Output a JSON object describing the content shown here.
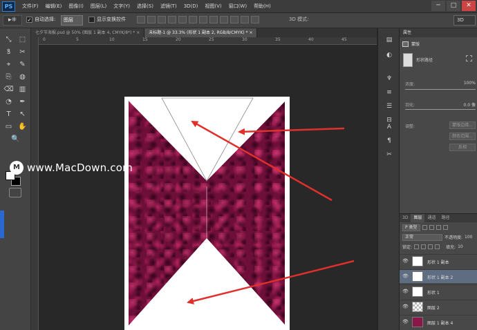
{
  "app": {
    "logo": "PS"
  },
  "menu": [
    "文件(F)",
    "编辑(E)",
    "图像(I)",
    "图层(L)",
    "文字(Y)",
    "选择(S)",
    "滤镜(T)",
    "3D(D)",
    "视图(V)",
    "窗口(W)",
    "帮助(H)"
  ],
  "window_controls": {
    "minimize": "─",
    "maximize": "□",
    "close": "✕"
  },
  "options": {
    "move_tool": "▸⁜",
    "auto_select_label": "自动选择:",
    "auto_select_value": "图层",
    "show_transform_label": "显示变换控件",
    "mode_3d_label": "3D 模式:",
    "workspace": "3D"
  },
  "tabs": [
    {
      "label": "七夕节海报.psd @ 50% (图层 1 副本 4, CMYK/8*) *",
      "close": "×"
    },
    {
      "label": "未标题-1 @ 33.3% (形状 1 副本 2, RGB/8/CMYK) *",
      "close": "×"
    }
  ],
  "ruler": {
    "ticks": [
      "0",
      "5",
      "10",
      "15",
      "20",
      "25",
      "30",
      "35",
      "40",
      "45"
    ]
  },
  "tools": [
    "⤡",
    "⬚",
    "ꝸ",
    "✂",
    "⌖",
    "✎",
    "⎘",
    "◍",
    "⌫",
    "▥",
    "◔",
    "✒",
    "T",
    "↖",
    "▭",
    "✋",
    "🔍"
  ],
  "watermark": {
    "icon": "M",
    "text": "www.MacDown.com"
  },
  "properties": {
    "title": "属性",
    "tab_label": "蒙版",
    "shape_label": "形状路径",
    "density_label": "浓度:",
    "density_value": "100%",
    "feather_label": "羽化:",
    "feather_value": "0.0 像",
    "adjust_label": "调整:",
    "btn_edge": "蒙版边缘...",
    "btn_color": "颜色范围...",
    "btn_invert": "反相"
  },
  "sidestrip_icons": [
    "▤",
    "◐",
    "♆",
    "≡",
    "☰",
    "⊟",
    "A",
    "¶",
    "✂"
  ],
  "layers": {
    "tabs": [
      "3D",
      "图层",
      "通道",
      "路径"
    ],
    "filter_kind": "P 类型",
    "blend_mode": "正常",
    "opacity_label": "不透明度:",
    "opacity_value": "100",
    "lock_label": "锁定:",
    "fill_label": "填充:",
    "fill_value": "10",
    "list": [
      {
        "name": "形状 1 副本",
        "thumb": "white"
      },
      {
        "name": "形状 1 副本 2",
        "thumb": "white"
      },
      {
        "name": "形状 1",
        "thumb": "white"
      },
      {
        "name": "图层 2",
        "thumb": "checker"
      },
      {
        "name": "图层 1 副本 4",
        "thumb": "rose"
      }
    ],
    "selected_index": 1,
    "eye": "👁"
  },
  "colors": {
    "arrow": "#e0302c",
    "rose": "#8a1747",
    "selection": "#5f6d83"
  }
}
